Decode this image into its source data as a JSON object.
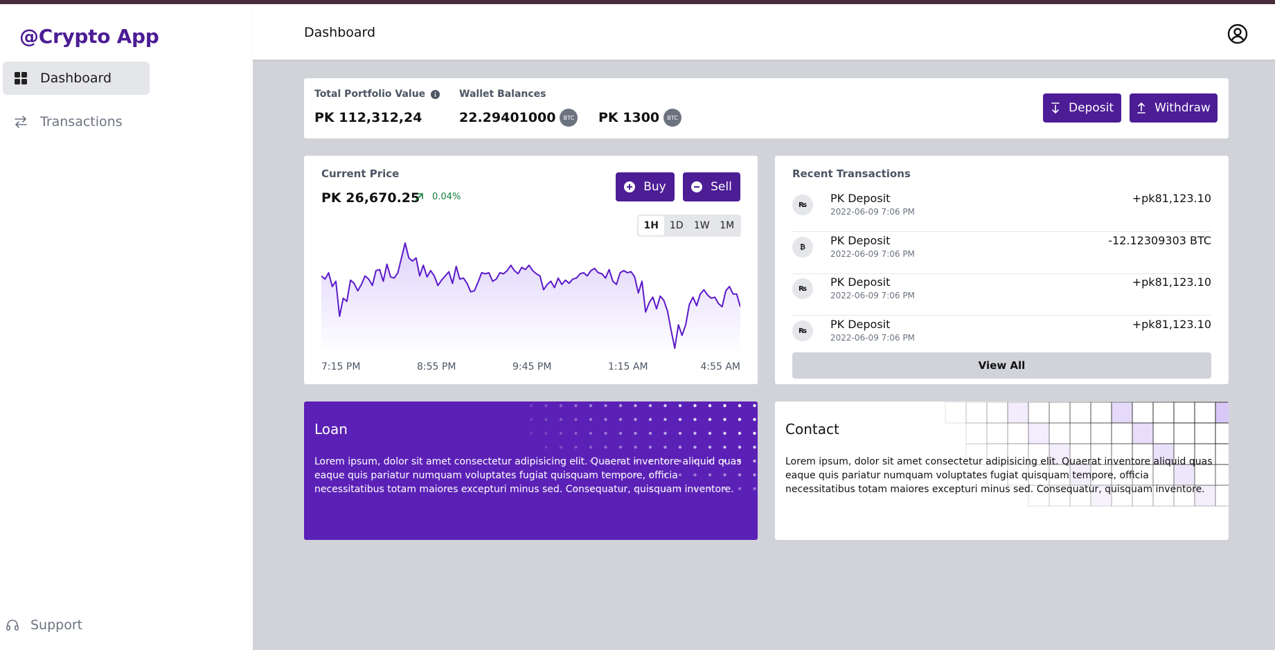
{
  "brand": "@Crypto App",
  "sidebar": {
    "items": [
      {
        "label": "Dashboard",
        "icon": "grid-icon"
      },
      {
        "label": "Transactions",
        "icon": "arrows-swap-icon"
      }
    ],
    "support_label": "Support"
  },
  "header": {
    "title": "Dashboard"
  },
  "summary": {
    "portfolio_label": "Total Portfolio Value",
    "portfolio_value": "PK 112,312,24",
    "wallet_label": "Wallet Balances",
    "wallet_btc_value": "22.29401000",
    "wallet_pk_value": "PK 1300",
    "btc_badge": "BTC",
    "deposit_label": "Deposit",
    "withdraw_label": "Withdraw"
  },
  "price": {
    "label": "Current Price",
    "value": "PK 26,670.25",
    "change": "0.04%",
    "buy_label": "Buy",
    "sell_label": "Sell",
    "timeframes": [
      "1H",
      "1D",
      "1W",
      "1M"
    ],
    "active_timeframe": "1H"
  },
  "chart_data": {
    "type": "area",
    "title": "",
    "xlabel": "",
    "ylabel": "",
    "x_ticks": [
      "7:15 PM",
      "8:55 PM",
      "9:45 PM",
      "1:15 AM",
      "4:55 AM"
    ],
    "series": [
      {
        "values": [
          70,
          67,
          73,
          60,
          65,
          32,
          49,
          46,
          66,
          63,
          56,
          62,
          70,
          67,
          61,
          75,
          76,
          65,
          81,
          69,
          68,
          73,
          87,
          101,
          87,
          84,
          87,
          70,
          80,
          69,
          75,
          70,
          61,
          66,
          70,
          74,
          63,
          79,
          67,
          68,
          63,
          55,
          56,
          64,
          73,
          72,
          73,
          65,
          67,
          73,
          72,
          75,
          80,
          75,
          72,
          78,
          76,
          80,
          75,
          72,
          70,
          57,
          62,
          65,
          59,
          68,
          62,
          66,
          63,
          67,
          68,
          72,
          73,
          70,
          75,
          77,
          73,
          72,
          68,
          76,
          65,
          62,
          73,
          75,
          73,
          74,
          69,
          54,
          65,
          36,
          45,
          50,
          39,
          51,
          47,
          37,
          19,
          2,
          24,
          14,
          24,
          43,
          50,
          42,
          53,
          57,
          52,
          49,
          50,
          44,
          41,
          56,
          60,
          53,
          53,
          41
        ]
      }
    ]
  },
  "transactions": {
    "title": "Recent Transactions",
    "items": [
      {
        "icon": "₨",
        "icon_name": "rupee-icon",
        "title": "PK Deposit",
        "date": "2022-06-09 7:06 PM",
        "amount": "+pk81,123.10"
      },
      {
        "icon": "₿",
        "icon_name": "bitcoin-icon",
        "title": "PK Deposit",
        "date": "2022-06-09 7:06 PM",
        "amount": "-12.12309303 BTC"
      },
      {
        "icon": "₨",
        "icon_name": "rupee-icon",
        "title": "PK Deposit",
        "date": "2022-06-09 7:06 PM",
        "amount": "+pk81,123.10"
      },
      {
        "icon": "₨",
        "icon_name": "rupee-icon",
        "title": "PK Deposit",
        "date": "2022-06-09 7:06 PM",
        "amount": "+pk81,123.10"
      }
    ],
    "view_all": "View All"
  },
  "loan": {
    "title": "Loan",
    "text": "Lorem ipsum, dolor sit amet consectetur adipisicing elit. Quaerat inventore aliquid quas eaque quis pariatur numquam voluptates fugiat quisquam tempore, officia necessitatibus totam maiores excepturi minus sed. Consequatur, quisquam inventore."
  },
  "contact": {
    "title": "Contact",
    "text": "Lorem ipsum, dolor sit amet consectetur adipisicing elit. Quaerat inventore aliquid quas eaque quis pariatur numquam voluptates fugiat quisquam tempore, officia necessitatibus totam maiores excepturi minus sed. Consequatur, quisquam inventore."
  },
  "colors": {
    "brand": "#4c1d95",
    "primary_button": "#4c1d95",
    "chart_line": "#5b18c9",
    "positive": "#15803d",
    "loan_bg": "#5b21b6",
    "page_bg": "#d1d3d9"
  }
}
